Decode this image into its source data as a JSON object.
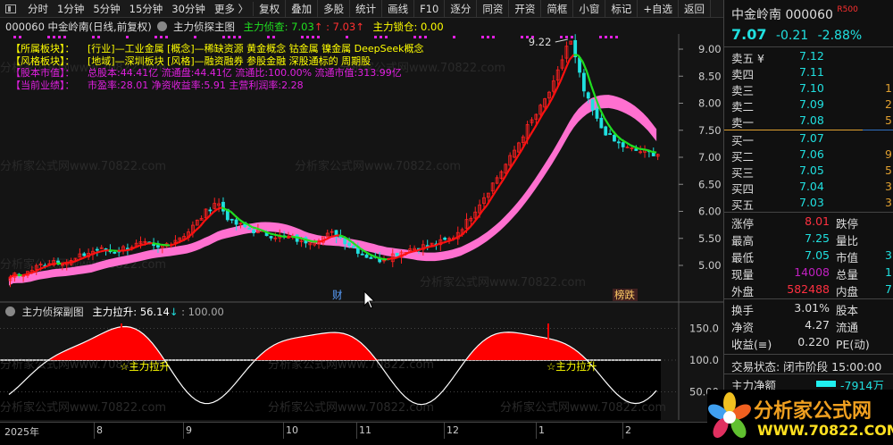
{
  "toolbar": {
    "periods": [
      "分时",
      "1分钟",
      "5分钟",
      "15分钟",
      "30分钟",
      "更多 〉"
    ],
    "buttons": [
      "复权",
      "叠加",
      "多股",
      "统计",
      "画线",
      "F10",
      "逐分",
      "同资",
      "开资",
      "简框",
      "小窗",
      "标记",
      "+自选",
      "返回"
    ]
  },
  "chart": {
    "title": "000060 中金岭南(日线,前复权)",
    "indicator": "主力侦探主图",
    "zhencha_label": "主力侦查: 7.03",
    "zhencha_arrow": "↑",
    "second_value": ": 7.03",
    "second_arrow": "↑",
    "lock_label": "主力锁仓: 0.00",
    "info": [
      {
        "label": "【所属板块】：",
        "text": "[行业]—工业金属 [概念]—稀缺资源 黄金概念 钴金属 镍金属 DeepSeek概念",
        "color": "#ffff00"
      },
      {
        "label": "【风格板块】：",
        "text": "[地域]—深圳板块 [风格]—融资融券 参股金融 深股通标的 周期股",
        "color": "#ffff00"
      },
      {
        "label": "【股本市值】：",
        "text": "总股本:44.41亿 流通盘:44.41亿 流通比:100.00% 流通市值:313.99亿",
        "color": "#e020e0"
      },
      {
        "label": "【当前业绩】：",
        "text": "市盈率:28.01 净资收益率:5.91 主营利润率:2.28",
        "color": "#e020e0"
      }
    ],
    "max_label": "9.22",
    "price_ticks": [
      "9.00",
      "8.50",
      "8.00",
      "7.50",
      "7.00",
      "6.50",
      "6.00",
      "5.50",
      "5.00"
    ],
    "markers": {
      "cai": "财",
      "bangdie": "榜跌"
    },
    "watermark": "分析家公式网www.70822.com"
  },
  "chart_data": {
    "type": "candlestick",
    "price_keypoints": [
      4.8,
      4.85,
      5.0,
      5.1,
      5.05,
      5.2,
      5.3,
      5.25,
      5.35,
      5.4,
      5.3,
      5.45,
      5.6,
      5.9,
      6.2,
      5.8,
      5.7,
      5.6,
      5.55,
      5.5,
      5.45,
      5.5,
      5.6,
      5.4,
      5.2,
      5.1,
      5.2,
      5.3,
      5.35,
      5.4,
      5.5,
      5.8,
      6.2,
      6.6,
      7.0,
      7.5,
      7.9,
      8.4,
      9.22,
      8.2,
      7.6,
      7.3,
      7.15,
      7.1,
      7.07
    ],
    "ylim": [
      4.6,
      9.3
    ],
    "sub": {
      "title": "主力侦探副图",
      "lift_label": "主力拉升: 56.14",
      "lift_arrow": "↓",
      "second": ": 100.00",
      "ticks": [
        "150.0",
        "100.0",
        "50.00"
      ],
      "signal": "☆主力拉升"
    },
    "x_labels": [
      "2025年",
      "8",
      "9",
      "10",
      "11",
      "12",
      "1",
      "2"
    ]
  },
  "quote": {
    "name": "中金岭南",
    "code": "000060",
    "badge": "R500",
    "price": "7.07",
    "change": "-0.21",
    "pct": "-2.88%"
  },
  "orderbook": [
    {
      "label": "卖五 ¥",
      "price": "7.12",
      "vol": ""
    },
    {
      "label": "卖四",
      "price": "7.11",
      "vol": ""
    },
    {
      "label": "卖三",
      "price": "7.10",
      "vol": "1"
    },
    {
      "label": "卖二",
      "price": "7.09",
      "vol": "2"
    },
    {
      "label": "卖一",
      "price": "7.08",
      "vol": "5"
    },
    {
      "label": "买一",
      "price": "7.07",
      "vol": ""
    },
    {
      "label": "买二",
      "price": "7.06",
      "vol": "9"
    },
    {
      "label": "买三",
      "price": "7.05",
      "vol": "5"
    },
    {
      "label": "买四",
      "price": "7.04",
      "vol": "3"
    },
    {
      "label": "买五",
      "price": "7.03",
      "vol": "3"
    }
  ],
  "stats": [
    {
      "l": "涨停",
      "v": "8.01",
      "c": "#ff3040",
      "l2": "跌停",
      "v2": ""
    },
    {
      "l": "最高",
      "v": "7.25",
      "c": "#20e0e0",
      "l2": "量比",
      "v2": ""
    },
    {
      "l": "最低",
      "v": "7.05",
      "c": "#20e0e0",
      "l2": "市值",
      "v2": "3"
    },
    {
      "l": "现量",
      "v": "14008",
      "c": "#c020c0",
      "l2": "总量",
      "v2": "1"
    },
    {
      "l": "外盘",
      "v": "582488",
      "c": "#ff3040",
      "l2": "内盘",
      "v2": "7"
    }
  ],
  "fin": [
    {
      "l": "换手",
      "v": "3.01%",
      "l2": "股本"
    },
    {
      "l": "净资",
      "v": "4.27",
      "l2": "流通"
    },
    {
      "l": "收益(≡)",
      "v": "0.220",
      "l2": "PE(动)"
    }
  ],
  "status": "交易状态: 闭市阶段 15:00:00",
  "net": {
    "label": "主力净额",
    "value": "-7914万"
  },
  "logo": {
    "title": "分析家公式网",
    "url": "WWW.70822.COM"
  },
  "colors": {
    "up": "#ff2020",
    "down": "#20e0e0",
    "ma": "#ff1010",
    "pink": "#ff70d0"
  }
}
